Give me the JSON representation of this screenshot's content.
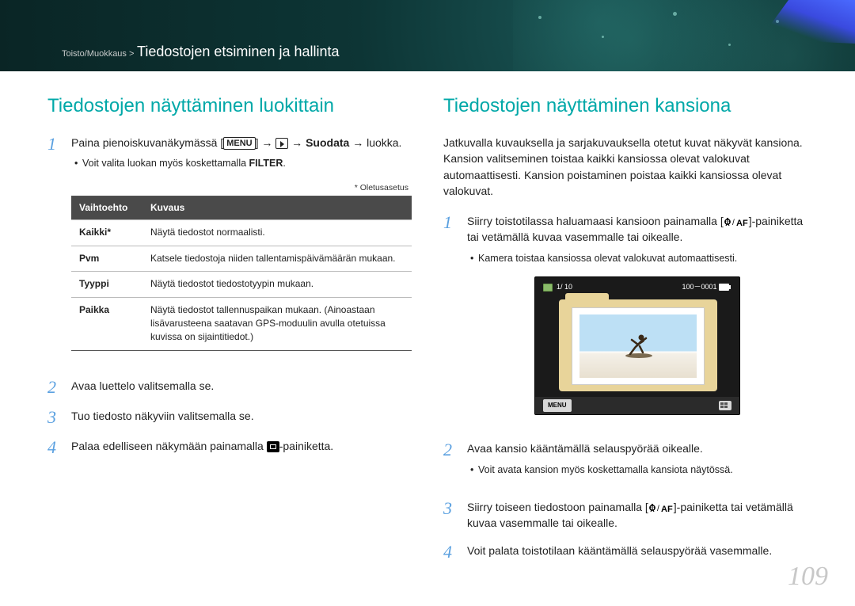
{
  "breadcrumb": {
    "section": "Toisto/Muokkaus >",
    "title": "Tiedostojen etsiminen ja hallinta"
  },
  "left": {
    "heading": "Tiedostojen näyttäminen luokittain",
    "step1_a": "Paina pienoiskuvanäkymässä [",
    "step1_menu": "MENU",
    "step1_b": "] → ",
    "step1_c": " → ",
    "step1_bold": "Suodata",
    "step1_d": " → luokka.",
    "bullet1_a": "Voit valita luokan myös koskettamalla ",
    "bullet1_b": "FILTER",
    "bullet1_c": ".",
    "footnote": "* Oletusasetus",
    "th1": "Vaihtoehto",
    "th2": "Kuvaus",
    "rows": [
      {
        "opt": "Kaikki*",
        "desc": "Näytä tiedostot normaalisti."
      },
      {
        "opt": "Pvm",
        "desc": "Katsele tiedostoja niiden tallentamispäivämäärän mukaan."
      },
      {
        "opt": "Tyyppi",
        "desc": "Näytä tiedostot tiedostotyypin mukaan."
      },
      {
        "opt": "Paikka",
        "desc": "Näytä tiedostot tallennuspaikan mukaan. (Ainoastaan lisävarusteena saatavan GPS-moduulin avulla otetuissa kuvissa on sijaintitiedot.)"
      }
    ],
    "step2": "Avaa luettelo valitsemalla se.",
    "step3": "Tuo tiedosto näkyviin valitsemalla se.",
    "step4_a": "Palaa edelliseen näkymään painamalla ",
    "step4_b": "-painiketta."
  },
  "right": {
    "heading": "Tiedostojen näyttäminen kansiona",
    "intro": "Jatkuvalla kuvauksella ja sarjakuvauksella otetut kuvat näkyvät kansiona. Kansion valitseminen toistaa kaikki kansiossa olevat valokuvat automaattisesti. Kansion poistaminen poistaa kaikki kansiossa olevat valokuvat.",
    "step1_a": "Siirry toistotilassa haluamaasi kansioon painamalla [",
    "step1_b": "]-painiketta tai vetämällä kuvaa vasemmalle tai oikealle.",
    "bullet1": "Kamera toistaa kansiossa olevat valokuvat automaattisesti.",
    "preview": {
      "counter": "1/ 10",
      "fileno": "100－0001",
      "menu": "MENU"
    },
    "step2": "Avaa kansio kääntämällä selauspyörää oikealle.",
    "bullet2": "Voit avata kansion myös koskettamalla kansiota näytössä.",
    "step3_a": "Siirry toiseen tiedostoon painamalla [",
    "step3_b": "]-painiketta tai vetämällä kuvaa vasemmalle tai oikealle.",
    "step4": "Voit palata toistotilaan kääntämällä selauspyörää vasemmalle."
  },
  "page_number": "109"
}
